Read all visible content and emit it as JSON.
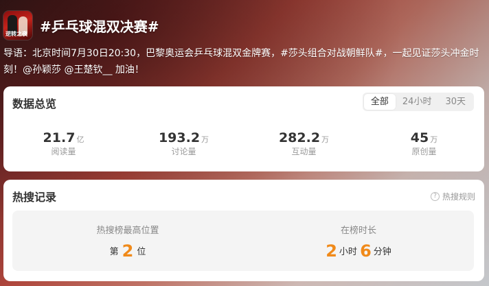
{
  "header": {
    "title": "#乒乓球混双决赛#",
    "avatar_text": "逆转之夜"
  },
  "guide": "导语：北京时间7月30日20:30，巴黎奥运会乒乓球混双金牌赛，#莎头组合对战朝鲜队#，一起见证莎头冲金时刻！@孙颖莎 @王楚钦__ 加油！",
  "overview": {
    "title": "数据总览",
    "tabs": [
      "全部",
      "24小时",
      "30天"
    ],
    "stats": [
      {
        "value": "21.7",
        "unit": "亿",
        "label": "阅读量"
      },
      {
        "value": "193.2",
        "unit": "万",
        "label": "讨论量"
      },
      {
        "value": "282.2",
        "unit": "万",
        "label": "互动量"
      },
      {
        "value": "45",
        "unit": "万",
        "label": "原创量"
      }
    ]
  },
  "hot": {
    "title": "热搜记录",
    "rules_label": "热搜规则",
    "rules_icon": "question-circle-icon",
    "peak": {
      "label": "热搜榜最高位置",
      "prefix": "第",
      "value": "2",
      "suffix": "位"
    },
    "duration": {
      "label": "在榜时长",
      "hours": "2",
      "hours_unit": "小时",
      "minutes": "6",
      "minutes_unit": "分钟"
    }
  },
  "colors": {
    "accent": "#f08a1a",
    "card_bg": "#ffffff",
    "panel_bg": "#f4f4f4"
  }
}
